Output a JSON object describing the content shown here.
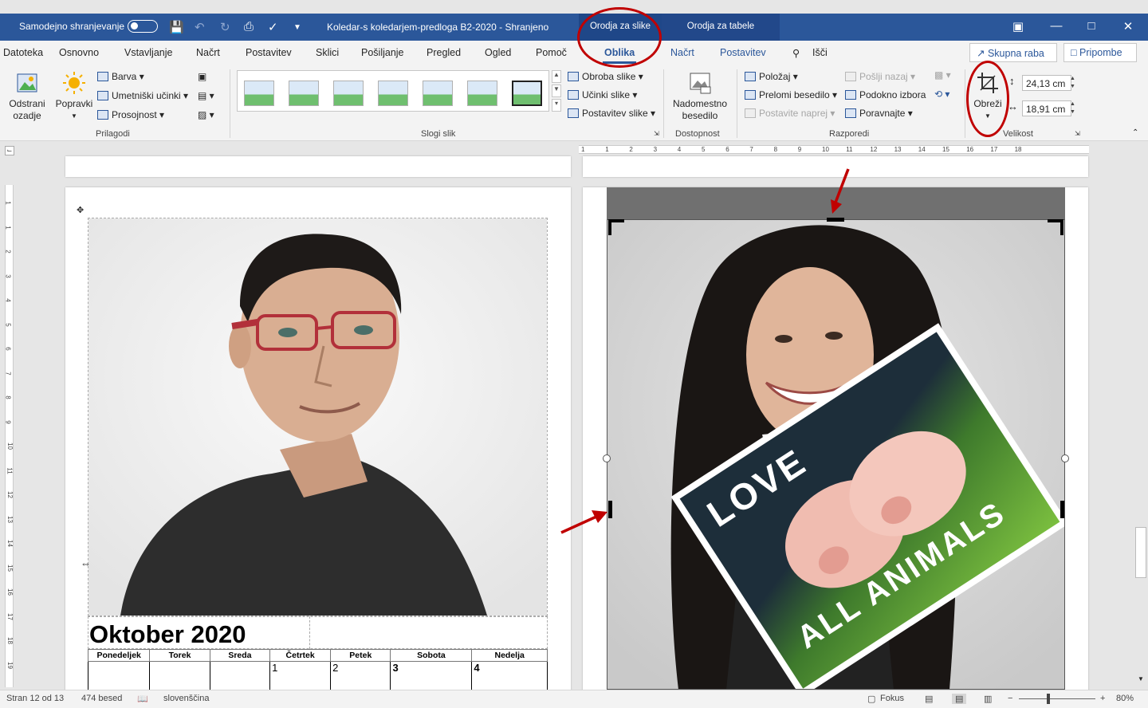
{
  "titlebar": {
    "autosave_label": "Samodejno shranjevanje",
    "doc_title": "Koledar-s koledarjem-predloga B2-2020  -  Shranjeno",
    "context_picture_tools": "Orodja za slike",
    "context_table_tools": "Orodja za tabele"
  },
  "tabs": {
    "file": "Datoteka",
    "home": "Osnovno",
    "insert": "Vstavljanje",
    "design": "Načrt",
    "layout": "Postavitev",
    "references": "Sklici",
    "mailings": "Pošiljanje",
    "review": "Pregled",
    "view": "Ogled",
    "help": "Pomoč",
    "format": "Oblika",
    "table_design": "Načrt",
    "table_layout": "Postavitev",
    "search": "Išči",
    "share": "Skupna raba",
    "comments": "Pripombe"
  },
  "ribbon": {
    "remove_bg_line1": "Odstrani",
    "remove_bg_line2": "ozadje",
    "corrections": "Popravki",
    "color": "Barva",
    "artistic": "Umetniški učinki",
    "transparency": "Prosojnost",
    "group_adjust": "Prilagodi",
    "group_styles": "Slogi slik",
    "border": "Obroba slike",
    "effects": "Učinki slike",
    "picture_layout": "Postavitev slike",
    "alt_text_line1": "Nadomestno",
    "alt_text_line2": "besedilo",
    "group_access": "Dostopnost",
    "position": "Položaj",
    "wrap_text": "Prelomi besedilo",
    "bring_forward": "Postavite naprej",
    "send_backward": "Pošlji nazaj",
    "selection_pane": "Podokno izbora",
    "align": "Poravnajte",
    "group_arrange": "Razporedi",
    "crop": "Obreži",
    "height": "24,13 cm",
    "width": "18,91 cm",
    "group_size": "Velikost"
  },
  "calendar": {
    "title": "Oktober 2020",
    "days": [
      "Ponedeljek",
      "Torek",
      "Sreda",
      "Četrtek",
      "Petek",
      "Sobota",
      "Nedelja"
    ],
    "dates": [
      "",
      "",
      "",
      "1",
      "2",
      "3",
      "4"
    ]
  },
  "photo2": {
    "sign_line1": "LOVE",
    "sign_line2": "ALL ANIMALS"
  },
  "ruler": {
    "h_numbers": [
      "1",
      "1",
      "2",
      "3",
      "4",
      "5",
      "6",
      "7",
      "8",
      "9",
      "10",
      "11",
      "12",
      "13",
      "14",
      "15",
      "16",
      "17",
      "18"
    ],
    "v_numbers": [
      "1",
      "1",
      "2",
      "3",
      "4",
      "5",
      "6",
      "7",
      "8",
      "9",
      "10",
      "11",
      "12",
      "13",
      "14",
      "15",
      "16",
      "17",
      "18",
      "19"
    ]
  },
  "status": {
    "page": "Stran 12 od 13",
    "words": "474 besed",
    "language": "slovenščina",
    "focus": "Fokus",
    "zoom": "80%"
  },
  "colors": {
    "accent": "#2b579a",
    "annotation": "#c00000"
  }
}
